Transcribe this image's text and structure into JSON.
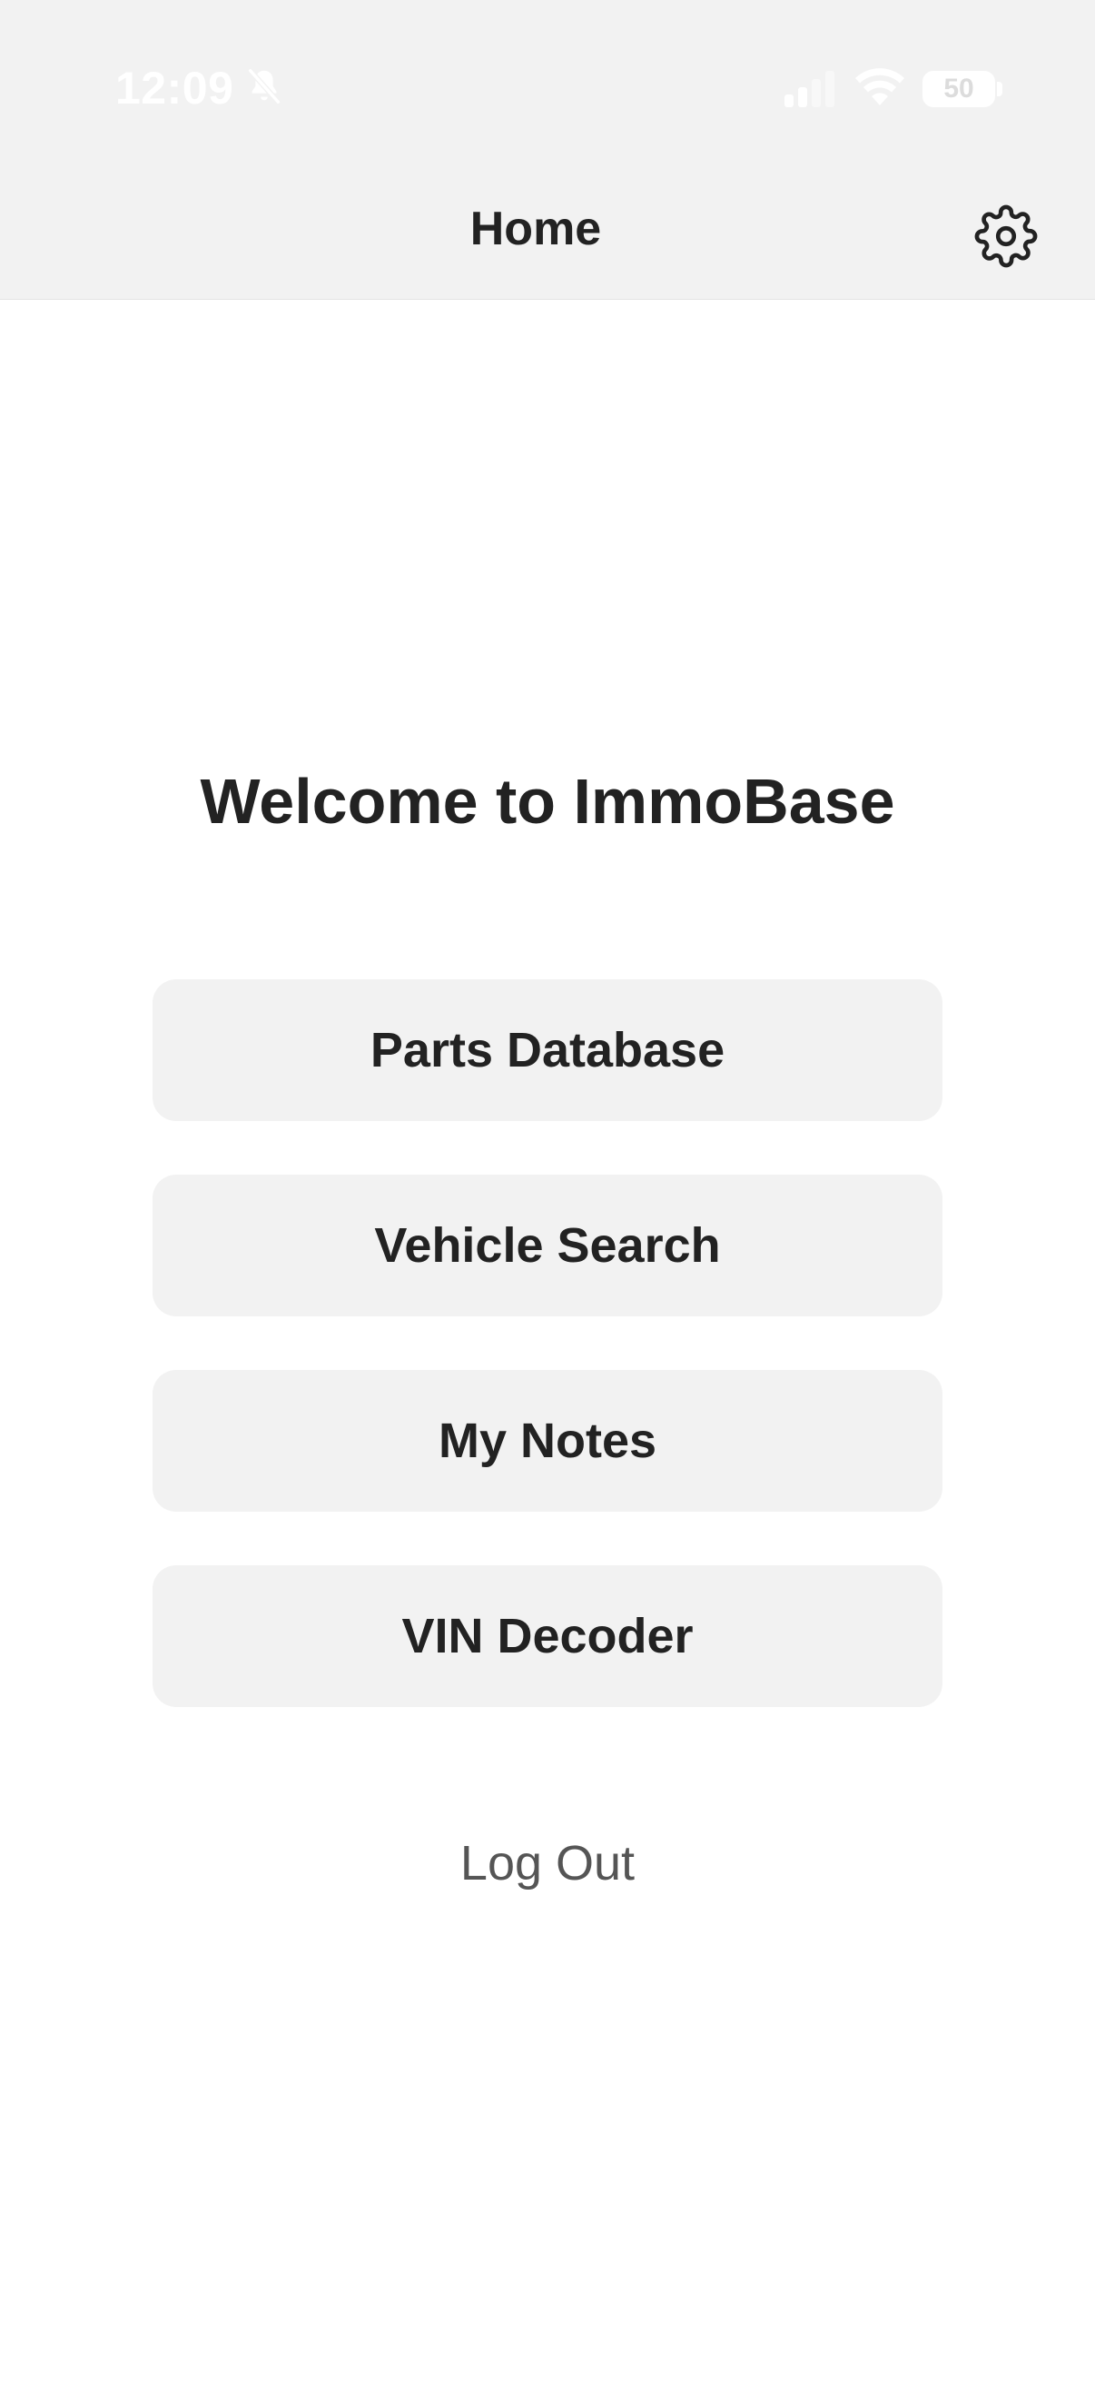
{
  "status_bar": {
    "time": "12:09",
    "battery_percent": "50",
    "icons": [
      "bell-slash-icon",
      "signal-icon",
      "wifi-icon",
      "battery-icon"
    ]
  },
  "nav": {
    "title": "Home",
    "settings_icon": "gear-icon"
  },
  "main": {
    "welcome_title": "Welcome to ImmoBase",
    "menu": [
      {
        "label": "Parts Database"
      },
      {
        "label": "Vehicle Search"
      },
      {
        "label": "My Notes"
      },
      {
        "label": "VIN Decoder"
      }
    ],
    "logout_label": "Log Out"
  },
  "colors": {
    "header_background": "#f2f2f2",
    "page_background": "#ffffff",
    "button_background": "#f2f2f2",
    "primary_text": "#222222",
    "secondary_text": "#555555"
  }
}
